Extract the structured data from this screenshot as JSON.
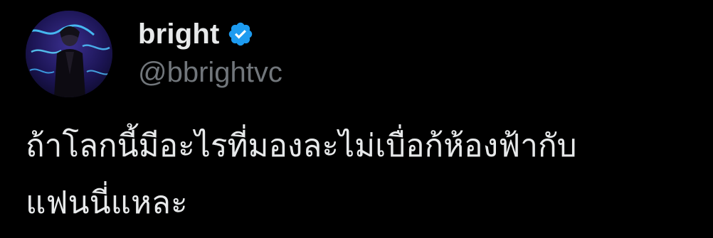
{
  "author": {
    "display_name": "bright",
    "handle": "@bbrightvc",
    "verified": true,
    "avatar_icon": "profile-photo",
    "verified_icon": "verified-badge-icon"
  },
  "tweet": {
    "line_1": "ถ้าโลกนี้มีอะไรที่มองละไม่เบื่อก้ห้องฟ้ากับ",
    "line_2": "แฟนนี่แหละ"
  },
  "colors": {
    "background": "#000000",
    "text_primary": "#e7e9ea",
    "text_secondary": "#71767b",
    "verified_blue": "#1d9bf0"
  }
}
